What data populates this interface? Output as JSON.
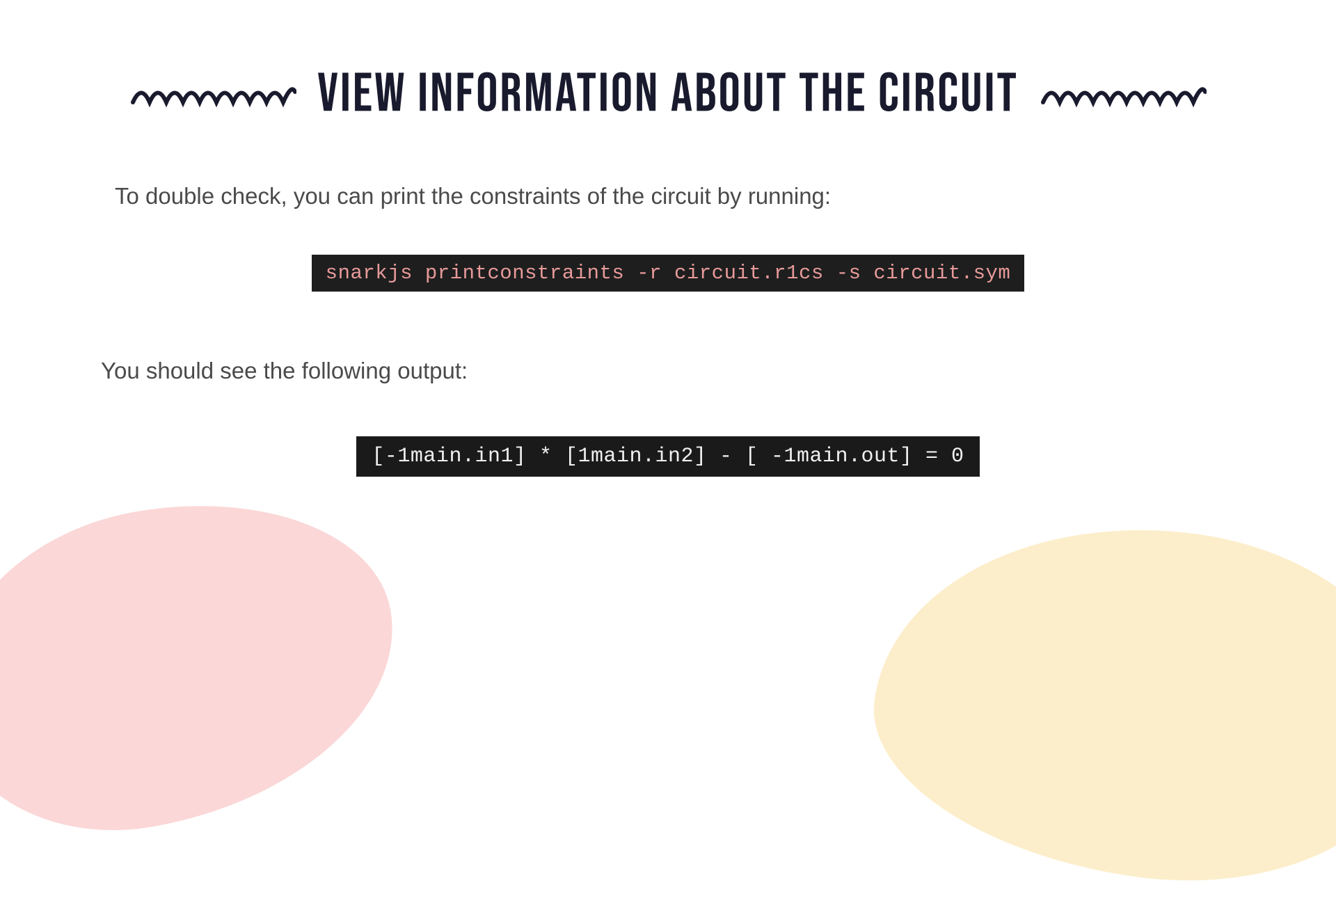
{
  "title": "View information about the circuit",
  "intro_text": "To double check, you can print the constraints of the circuit by running:",
  "command": "snarkjs printconstraints -r circuit.r1cs -s circuit.sym",
  "output_label": "You should see the following output:",
  "constraint_output": "[-1main.in1] * [1main.in2] - [ -1main.out] = 0",
  "colors": {
    "blob_pink": "#fbd7d7",
    "blob_cream": "#fdeecb",
    "title_color": "#1a1a2e",
    "text_color": "#4a4a4a",
    "code_bg": "#1e1e1e",
    "code_pink": "#e89a9a",
    "code_white": "#f0f0f0"
  }
}
